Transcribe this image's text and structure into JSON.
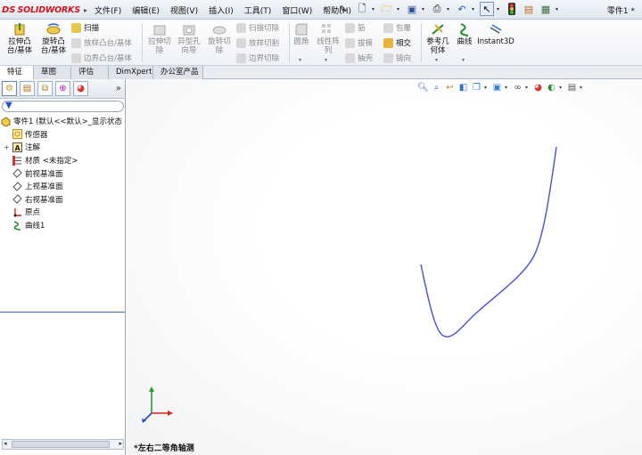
{
  "app": {
    "logo_ds": "DS",
    "logo_brand": "SOLIDWORKS",
    "document_title": "零件1 *"
  },
  "menu": [
    "文件(F)",
    "编辑(E)",
    "视图(V)",
    "插入(I)",
    "工具(T)",
    "窗口(W)",
    "帮助(H)"
  ],
  "quick_access": [
    {
      "icon": "new-doc-icon",
      "glyph": "🗋"
    },
    {
      "icon": "open-folder-icon",
      "glyph": "📂"
    },
    {
      "icon": "save-icon",
      "glyph": "💾"
    },
    {
      "icon": "print-icon",
      "glyph": "🖨"
    },
    {
      "icon": "undo-icon",
      "glyph": "↶"
    },
    {
      "icon": "select-icon",
      "glyph": "↖"
    },
    {
      "icon": "rebuild-icon",
      "glyph": "🚦"
    },
    {
      "icon": "file-props-icon",
      "glyph": "📋"
    },
    {
      "icon": "options-icon",
      "glyph": "▦"
    }
  ],
  "commands": {
    "extrude_boss": "拉伸凸\n台/基体",
    "revolve_boss": "旋转凸\n台/基体",
    "sweep": "扫描",
    "loft_boss": "放样凸台/基体",
    "boundary_boss": "边界凸台/基体",
    "extrude_cut": "拉伸切\n除",
    "hole_wizard": "异型孔\n向导",
    "revolve_cut": "旋转切\n除",
    "swept_cut": "扫描切除",
    "lofted_cut": "放样切割",
    "boundary_cut": "边界切除",
    "fillet": "圆角",
    "linear_pattern": "线性阵\n列",
    "rib": "筋",
    "draft": "拔模",
    "shell": "抽壳",
    "wrap": "包覆",
    "intersect": "相交",
    "mirror": "镜向",
    "ref_geometry": "参考几\n何体",
    "curves": "曲线",
    "instant3d": "Instant3D"
  },
  "tabs": [
    "特征",
    "草图",
    "评估",
    "DimXpert",
    "办公室产品"
  ],
  "feature_tree": {
    "filter_glyph": "▼",
    "nodes": [
      {
        "label": "零件1  (默认<<默认>_显示状态",
        "icon": "part-icon",
        "indent": 0
      },
      {
        "label": "传感器",
        "icon": "sensor-icon",
        "indent": 1
      },
      {
        "label": "注解",
        "icon": "annotation-icon",
        "indent": 1,
        "expand": "+"
      },
      {
        "label": "材质 <未指定>",
        "icon": "material-icon",
        "indent": 1
      },
      {
        "label": "前视基准面",
        "icon": "plane-icon",
        "indent": 1
      },
      {
        "label": "上视基准面",
        "icon": "plane-icon",
        "indent": 1
      },
      {
        "label": "右视基准面",
        "icon": "plane-icon",
        "indent": 1
      },
      {
        "label": "原点",
        "icon": "origin-icon",
        "indent": 1
      },
      {
        "label": "曲线1",
        "icon": "curve-icon",
        "indent": 1
      }
    ]
  },
  "viewport": {
    "view_orientation": "*左右二等角轴测",
    "curve_color": "#4a4ed8"
  }
}
